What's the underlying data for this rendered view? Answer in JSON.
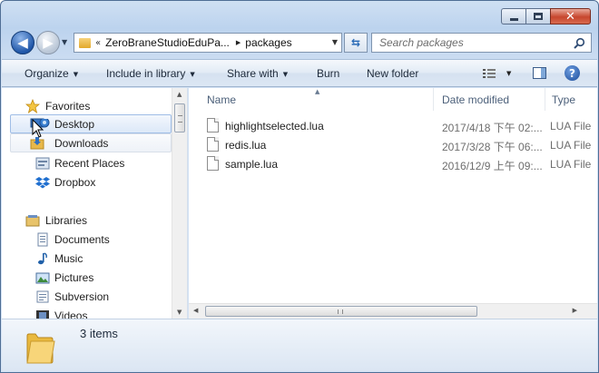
{
  "window": {
    "controls": {
      "minimize_icon": "minimize-icon",
      "maximize_icon": "maximize-icon",
      "close_icon": "close-icon"
    }
  },
  "address_bar": {
    "overflow_chevron": "«",
    "segments": [
      "ZeroBraneStudioEduPa...",
      "packages"
    ],
    "refresh_icon": "refresh-icon"
  },
  "search": {
    "placeholder": "Search packages"
  },
  "toolbar": {
    "organize": "Organize",
    "include_in_library": "Include in library",
    "share_with": "Share with",
    "burn": "Burn",
    "new_folder": "New folder"
  },
  "sidebar": {
    "favorites": {
      "label": "Favorites",
      "items": [
        {
          "label": "Desktop",
          "icon": "desktop-icon"
        },
        {
          "label": "Downloads",
          "icon": "downloads-icon"
        },
        {
          "label": "Recent Places",
          "icon": "recent-places-icon"
        },
        {
          "label": "Dropbox",
          "icon": "dropbox-icon"
        }
      ]
    },
    "libraries": {
      "label": "Libraries",
      "items": [
        {
          "label": "Documents",
          "icon": "documents-icon"
        },
        {
          "label": "Music",
          "icon": "music-icon"
        },
        {
          "label": "Pictures",
          "icon": "pictures-icon"
        },
        {
          "label": "Subversion",
          "icon": "subversion-icon"
        },
        {
          "label": "Videos",
          "icon": "videos-icon"
        }
      ]
    }
  },
  "file_list": {
    "columns": [
      "Name",
      "Date modified",
      "Type"
    ],
    "rows": [
      {
        "name": "highlightselected.lua",
        "date": "2017/4/18 下午 02:...",
        "type": "LUA File"
      },
      {
        "name": "redis.lua",
        "date": "2017/3/28 下午 06:...",
        "type": "LUA File"
      },
      {
        "name": "sample.lua",
        "date": "2016/12/9 上午 09:...",
        "type": "LUA File"
      }
    ],
    "scroll_grip": "III"
  },
  "details": {
    "item_count": "3 items"
  },
  "colors": {
    "accent": "#2a6bb6",
    "selection": "#dce8f8",
    "window_chrome": "#c9dbf1"
  }
}
